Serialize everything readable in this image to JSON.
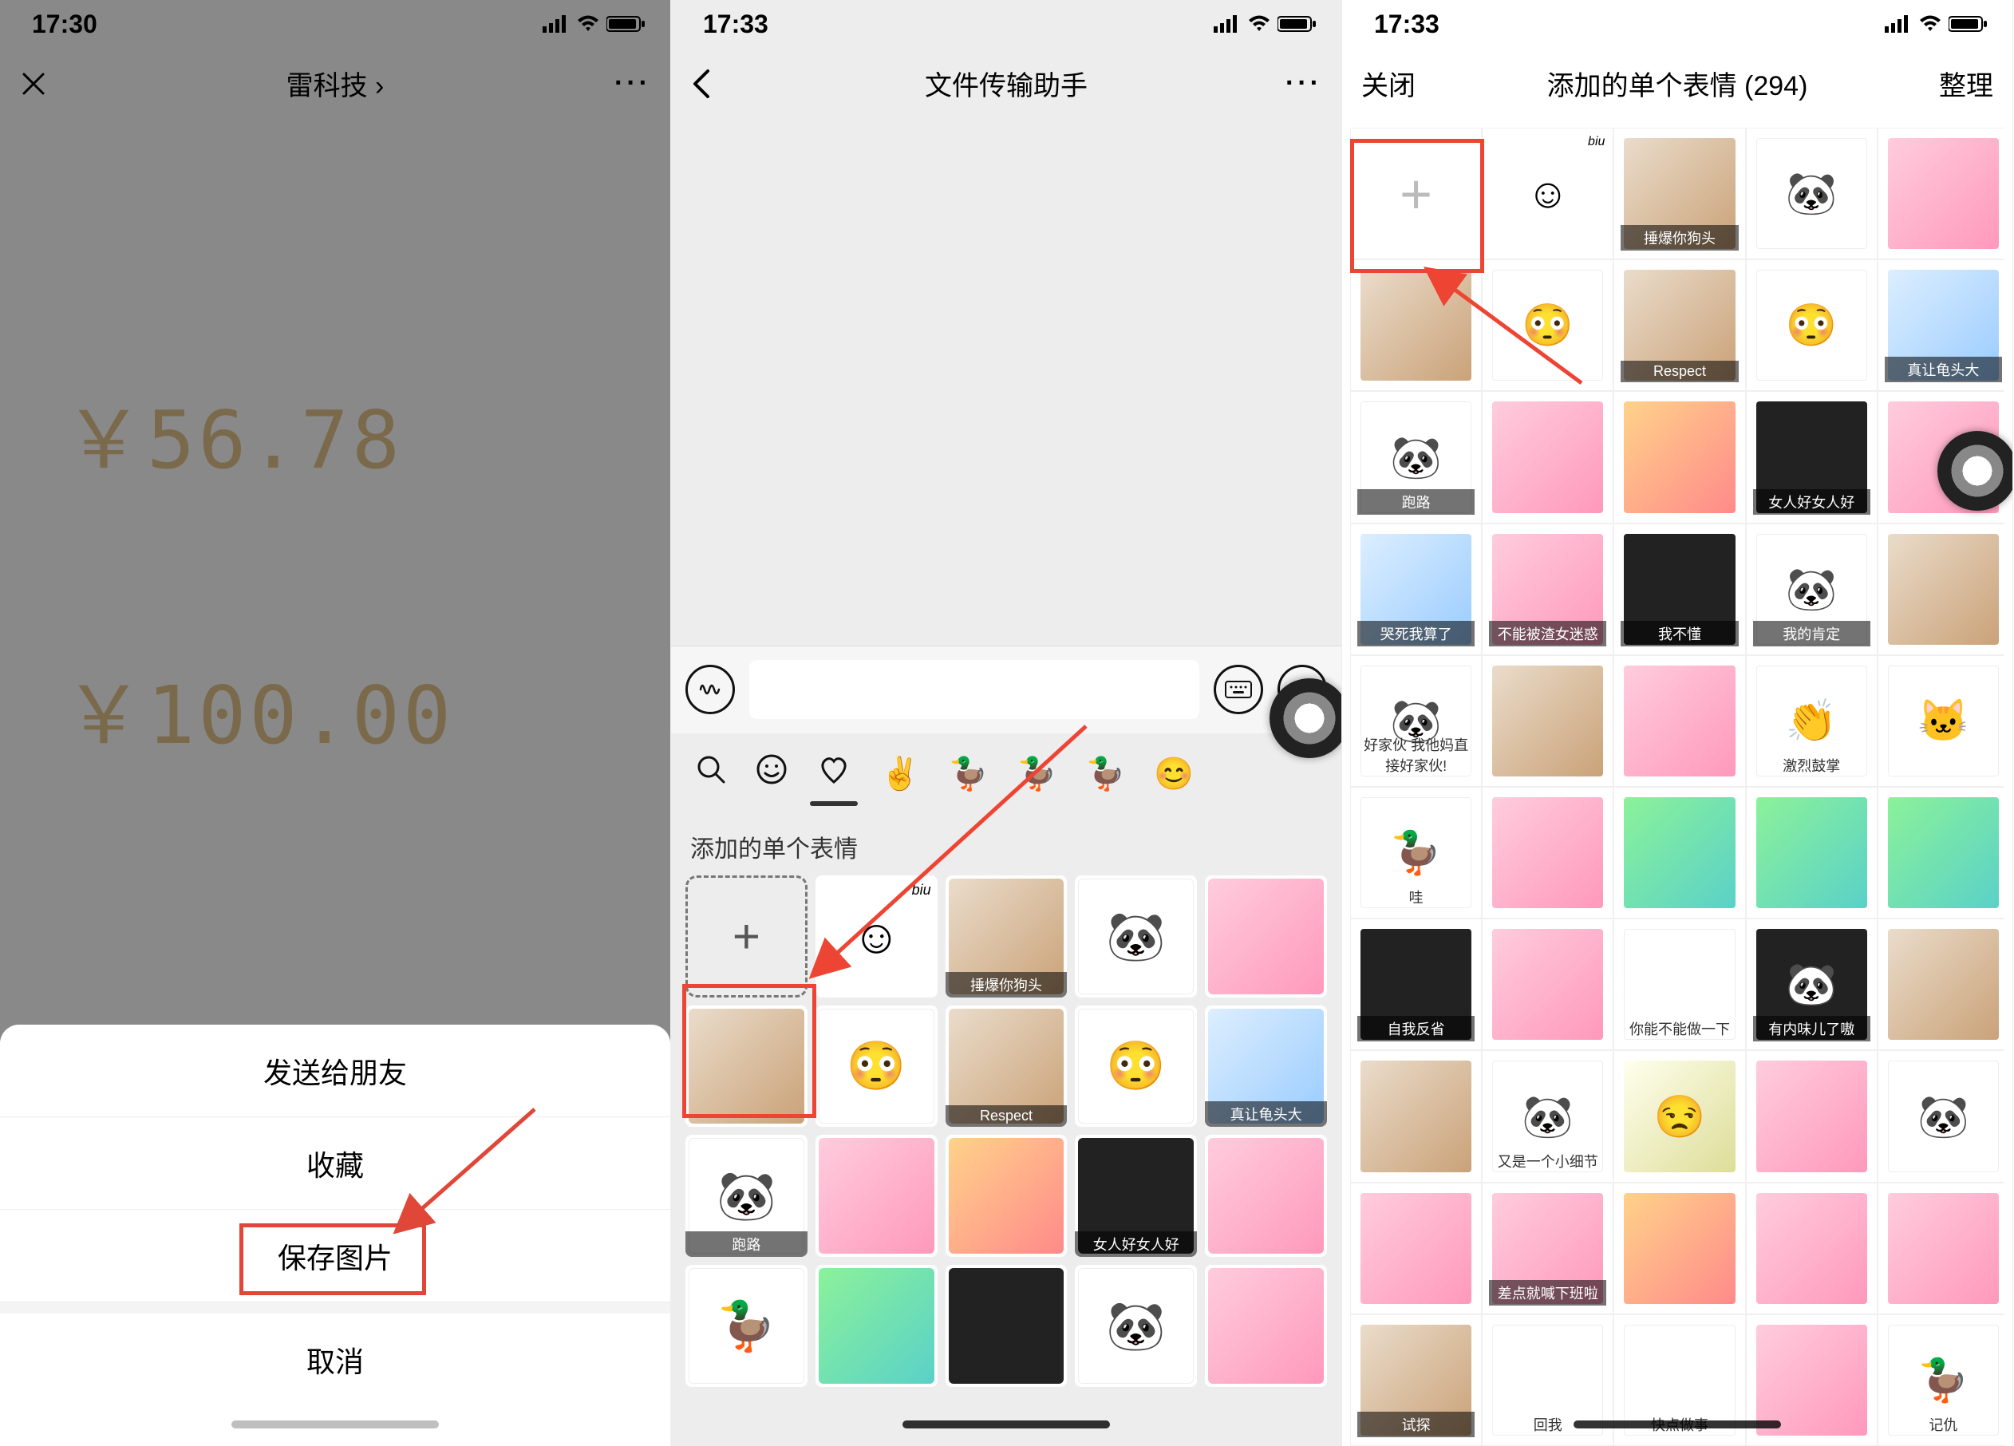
{
  "phone1": {
    "status_time": "17:30",
    "nav_title": "雷科技 ›",
    "nav_close_icon": "close-icon",
    "price1": "￥56.78",
    "price2": "￥100.00",
    "sheet": {
      "send": "发送给朋友",
      "fav": "收藏",
      "save": "保存图片",
      "cancel": "取消"
    }
  },
  "phone2": {
    "status_time": "17:33",
    "nav_title": "文件传输助手",
    "sticker_section_title": "添加的单个表情",
    "add_label": "+",
    "tiles": [
      {
        "id": "add",
        "type": "add"
      },
      {
        "id": "biu",
        "emoji": "☺",
        "tag": "biu"
      },
      {
        "id": "baby1",
        "cap": "捶爆你狗头",
        "hue": "e"
      },
      {
        "id": "panda-cat",
        "hue": "j",
        "emoji": "🐼"
      },
      {
        "id": "baby2",
        "hue": "h"
      },
      {
        "id": "man1",
        "hue": "e"
      },
      {
        "id": "emoji-twin",
        "emoji": "😳",
        "hue": "j"
      },
      {
        "id": "respect",
        "cap": "Respect",
        "hue": "e"
      },
      {
        "id": "emoji-twin2",
        "emoji": "😳",
        "hue": "j"
      },
      {
        "id": "squirtle",
        "cap": "真让龟头大",
        "hue": "g"
      },
      {
        "id": "panda-run",
        "cap": "跑路",
        "hue": "j",
        "emoji": "🐼"
      },
      {
        "id": "girl1",
        "hue": "h"
      },
      {
        "id": "girl-drink",
        "hue": "b"
      },
      {
        "id": "girl-saber",
        "cap": "女人好女人好",
        "hue": "f"
      },
      {
        "id": "baby3",
        "hue": "h"
      },
      {
        "id": "duck-cry",
        "hue": "j",
        "emoji": "🦆"
      },
      {
        "id": "baby-green",
        "hue": "d"
      },
      {
        "id": "dark-kid",
        "hue": "f"
      },
      {
        "id": "panda-line",
        "hue": "j",
        "emoji": "🐼"
      },
      {
        "id": "baby-puff",
        "hue": "h"
      }
    ]
  },
  "phone3": {
    "status_time": "17:33",
    "nav_close": "关闭",
    "nav_title": "添加的单个表情 (294)",
    "nav_manage": "整理",
    "added_sticker_count": 294,
    "cells": [
      {
        "type": "add"
      },
      {
        "emoji": "☺",
        "tag": "biu"
      },
      {
        "hue": "e",
        "cap": "捶爆你狗头"
      },
      {
        "hue": "j",
        "emoji": "🐼"
      },
      {
        "hue": "h"
      },
      {
        "hue": "e"
      },
      {
        "hue": "j",
        "emoji": "😳"
      },
      {
        "hue": "e",
        "cap": "Respect"
      },
      {
        "hue": "j",
        "emoji": "😳"
      },
      {
        "hue": "g",
        "cap": "真让龟头大"
      },
      {
        "hue": "j",
        "emoji": "🐼",
        "cap": "跑路"
      },
      {
        "hue": "h"
      },
      {
        "hue": "b"
      },
      {
        "hue": "f",
        "cap": "女人好女人好"
      },
      {
        "hue": "h"
      },
      {
        "hue": "g",
        "cap": "哭死我算了"
      },
      {
        "hue": "h",
        "cap": "不能被渣女迷惑"
      },
      {
        "hue": "f",
        "cap": "我不懂"
      },
      {
        "hue": "j",
        "emoji": "🐼",
        "cap": "我的肯定"
      },
      {
        "hue": "e"
      },
      {
        "hue": "j",
        "emoji": "🐼",
        "cap": "好家伙\n我他妈直接好家伙!",
        "bare": true
      },
      {
        "hue": "e"
      },
      {
        "hue": "h"
      },
      {
        "hue": "j",
        "cap": "激烈鼓掌",
        "bare": true,
        "emoji": "👏"
      },
      {
        "hue": "j",
        "emoji": "🐱"
      },
      {
        "hue": "j",
        "emoji": "🦆",
        "cap": "哇",
        "bare": true
      },
      {
        "hue": "h"
      },
      {
        "hue": "d"
      },
      {
        "hue": "d"
      },
      {
        "hue": "d"
      },
      {
        "hue": "f",
        "cap": "自我反省"
      },
      {
        "hue": "h"
      },
      {
        "hue": "j",
        "cap": "你能不能做一下",
        "bare": true
      },
      {
        "hue": "f",
        "cap": "有内味儿了嗷",
        "emoji": "🐼"
      },
      {
        "hue": "e"
      },
      {
        "hue": "e"
      },
      {
        "hue": "j",
        "emoji": "🐼",
        "cap": "又是一个小细节",
        "bare": true
      },
      {
        "hue": "i",
        "emoji": "😒"
      },
      {
        "hue": "h"
      },
      {
        "hue": "j",
        "emoji": "🐼"
      },
      {
        "hue": "h"
      },
      {
        "hue": "h",
        "cap": "差点就喊下班啦"
      },
      {
        "hue": "b"
      },
      {
        "hue": "h"
      },
      {
        "hue": "h"
      },
      {
        "hue": "e",
        "cap": "试探"
      },
      {
        "hue": "j",
        "cap": "回我",
        "bare": true
      },
      {
        "hue": "j",
        "cap": "快点做事",
        "bare": true
      },
      {
        "hue": "h"
      },
      {
        "hue": "j",
        "cap": "记仇",
        "bare": true,
        "emoji": "🦆"
      }
    ]
  }
}
